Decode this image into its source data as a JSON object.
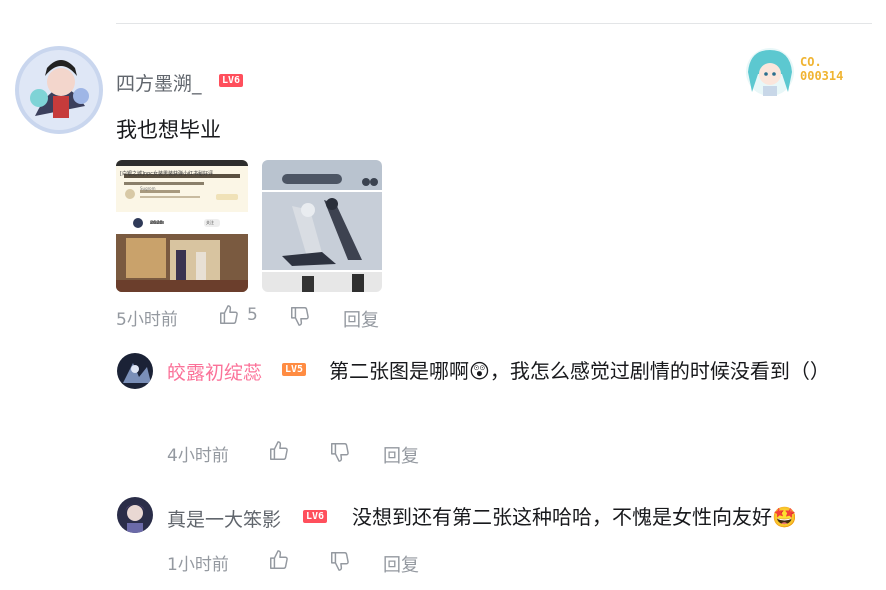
{
  "comment": {
    "username": "四方墨溯_",
    "level": "LV6",
    "text": "我也想毕业",
    "fan_badge": {
      "line1": "CO.",
      "line2": "000314"
    },
    "time": "5小时前",
    "likes": "5",
    "reply_label": "回复",
    "screenshot_text": {
      "title": "[白银之城]npc女装男装获弹小红书秘好评",
      "user": "Sugrom",
      "count": "2628",
      "btn": "关注"
    }
  },
  "replies": [
    {
      "username": "皎露初绽蕊",
      "level": "LV5",
      "text": "第二张图是哪啊😲，我怎么感觉过剧情的时候没看到（）",
      "time": "4小时前",
      "reply_label": "回复"
    },
    {
      "username": "真是一大笨影",
      "level": "LV6",
      "text": "没想到还有第二张这种哈哈，不愧是女性向友好🤩",
      "time": "1小时前",
      "reply_label": "回复"
    }
  ],
  "colors": {
    "accent": "#fb7299",
    "meta": "#9499a0",
    "text": "#18191c",
    "lv6": "#ff4f5c",
    "lv5": "#ff8c42",
    "badge": "#f0b432"
  },
  "icons": [
    "thumb-up-icon",
    "thumb-down-icon"
  ]
}
